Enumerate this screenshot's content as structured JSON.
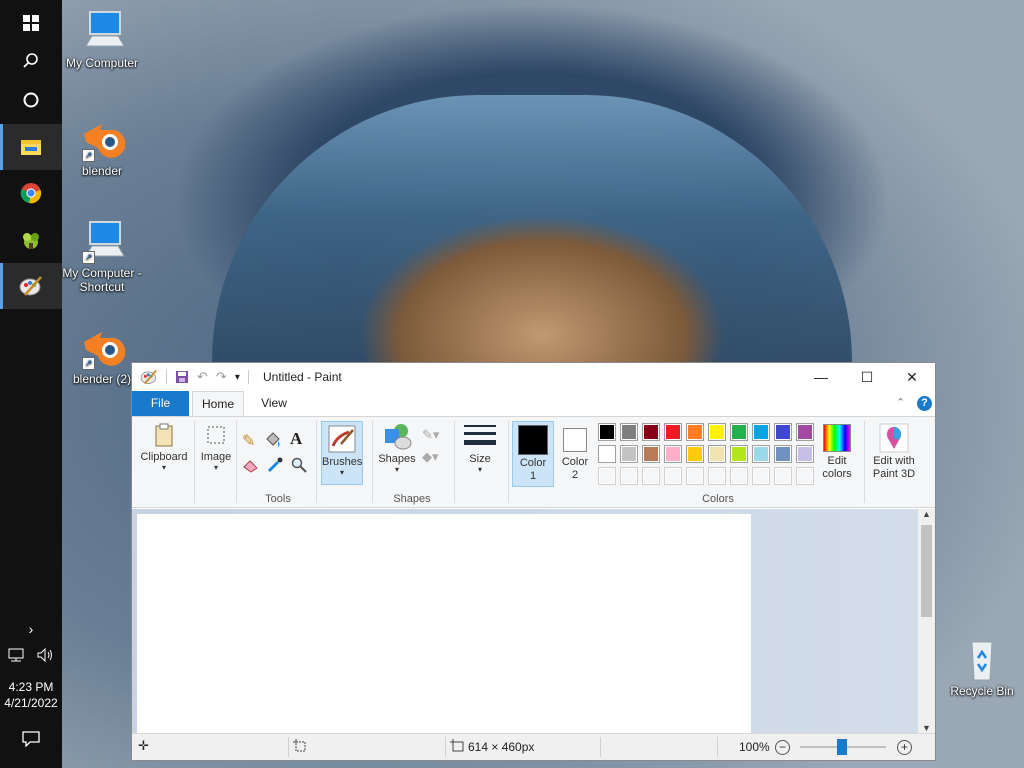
{
  "taskbar": {
    "start_icon": "windows-logo-icon",
    "search_icon": "search-icon",
    "cortana_icon": "circle-icon",
    "apps": [
      {
        "name": "file-explorer-icon",
        "color": "#f0c030"
      },
      {
        "name": "chrome-icon",
        "color": "#4285f4"
      },
      {
        "name": "app-leaf-icon",
        "color": "#7ab800"
      },
      {
        "name": "paint-icon",
        "color": "#5aa0e6"
      }
    ],
    "time": "4:23 PM",
    "date": "4/21/2022"
  },
  "desktop": {
    "icons": [
      {
        "label": "My Computer"
      },
      {
        "label": "blender"
      },
      {
        "label": "My Computer - Shortcut"
      },
      {
        "label": "blender (2)"
      },
      {
        "label": "Recycle Bin"
      }
    ]
  },
  "window": {
    "title": "Untitled - Paint",
    "controls": {
      "minimize": "—",
      "maximize": "☐",
      "close": "✕"
    },
    "tabs": {
      "file": "File",
      "home": "Home",
      "view": "View"
    },
    "ribbon": {
      "clipboard": "Clipboard",
      "image": "Image",
      "tools_label": "Tools",
      "brushes": "Brushes",
      "shapes": "Shapes",
      "shapes_label": "Shapes",
      "size": "Size",
      "color1": "Color 1",
      "color2": "Color 2",
      "colors_label": "Colors",
      "edit_colors": "Edit colors",
      "edit_paint3d": "Edit with Paint 3D",
      "help": "?"
    },
    "palette_row1": [
      "#000000",
      "#7f7f7f",
      "#880015",
      "#ed1c24",
      "#ff7f27",
      "#fff200",
      "#22b14c",
      "#00a2e8",
      "#3f48cc",
      "#a349a4"
    ],
    "palette_row2": [
      "#ffffff",
      "#c3c3c3",
      "#b97a57",
      "#ffaec9",
      "#ffc90e",
      "#efe4b0",
      "#b5e61d",
      "#99d9ea",
      "#7092be",
      "#c8bfe7"
    ],
    "color1_value": "#000000",
    "color2_value": "#ffffff",
    "status": {
      "image_size": "614 × 460px",
      "zoom": "100%"
    }
  }
}
